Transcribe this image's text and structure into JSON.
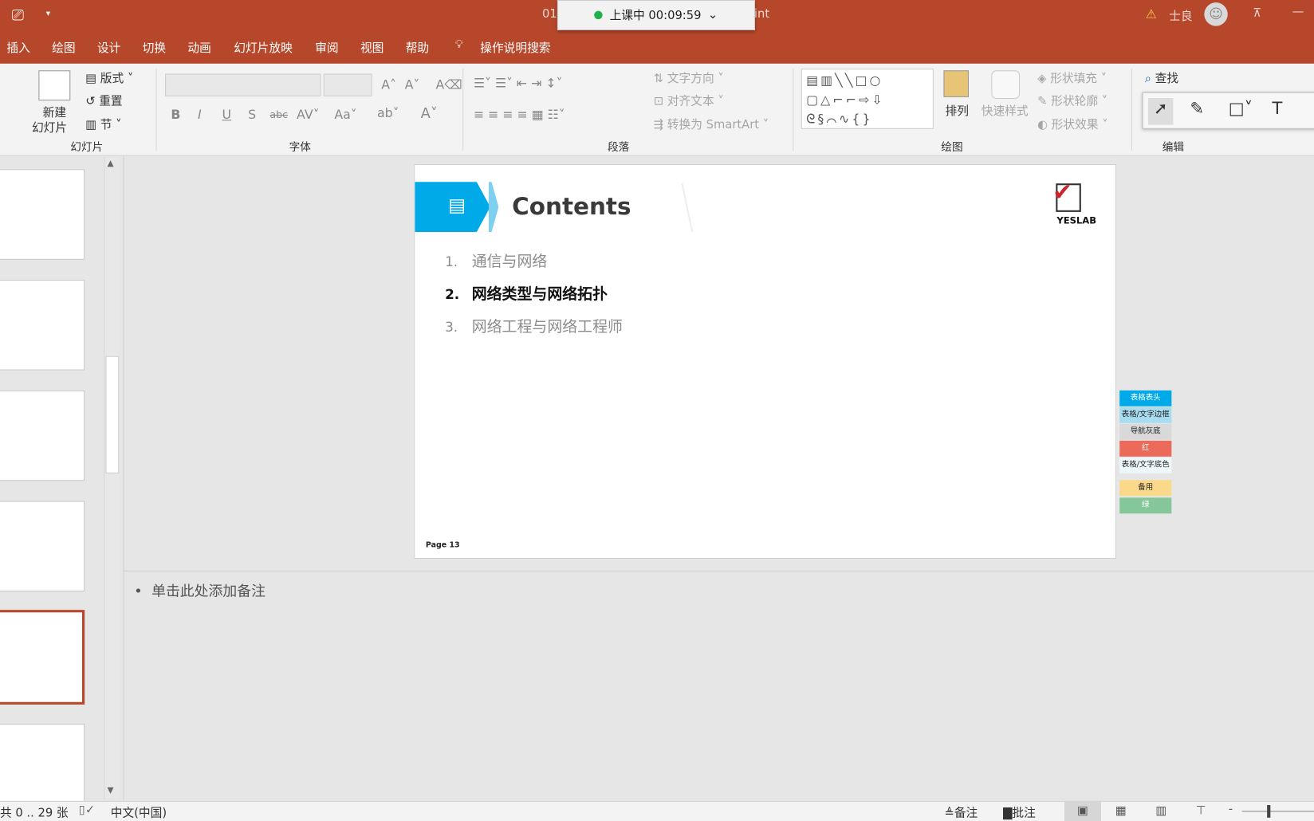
{
  "titlebar": {
    "file_prefix": "01",
    "app_suffix": "int",
    "user": "士良",
    "timer": "上课中 00:09:59"
  },
  "tabs": [
    "插入",
    "绘图",
    "设计",
    "切换",
    "动画",
    "幻灯片放映",
    "审阅",
    "视图",
    "帮助"
  ],
  "search": "操作说明搜索",
  "ribbon": {
    "slides": {
      "new_slide": "新建",
      "new_slide2": "幻灯片",
      "layout": "版式",
      "reset": "重置",
      "section": "节",
      "label": "幻灯片"
    },
    "font": {
      "label": "字体"
    },
    "paragraph": {
      "text_direction": "文字方向",
      "align_text": "对齐文本",
      "convert_smartart": "转换为 SmartArt",
      "label": "段落"
    },
    "drawing": {
      "arrange": "排列",
      "quick_styles": "快速样式",
      "shape_fill": "形状填充",
      "shape_outline": "形状轮廓",
      "shape_effects": "形状效果",
      "label": "绘图"
    },
    "editing": {
      "find": "查找",
      "label": "编辑"
    }
  },
  "slide": {
    "title": "Contents",
    "logo": "YESLAB",
    "items": [
      {
        "num": "1.",
        "text": "通信与网络",
        "active": false
      },
      {
        "num": "2.",
        "text": "网络类型与网络拓扑",
        "active": true
      },
      {
        "num": "3.",
        "text": "网络工程与网络工程师",
        "active": false
      }
    ],
    "page": "Page 13"
  },
  "swatches": [
    {
      "label": "表格表头",
      "color": "#00a9e8"
    },
    {
      "label": "表格/文字边框",
      "color": "#a8dcf0"
    },
    {
      "label": "导航灰底",
      "color": "#d9d9d9"
    },
    {
      "label": "红",
      "color": "#ec6a5a"
    },
    {
      "label": "表格/文字底色",
      "color": "#eef8fc"
    },
    {
      "label": "备用",
      "color": "#fbd98a"
    },
    {
      "label": "绿",
      "color": "#86c79a"
    }
  ],
  "notes": {
    "placeholder": "单击此处添加备注"
  },
  "status": {
    "slide_count": "共 0 .. 29 张",
    "language": "中文(中国)",
    "notes": "备注",
    "comments": "批注"
  },
  "colors": {
    "accent": "#b7472a",
    "slide_header": "#00a9e8"
  }
}
